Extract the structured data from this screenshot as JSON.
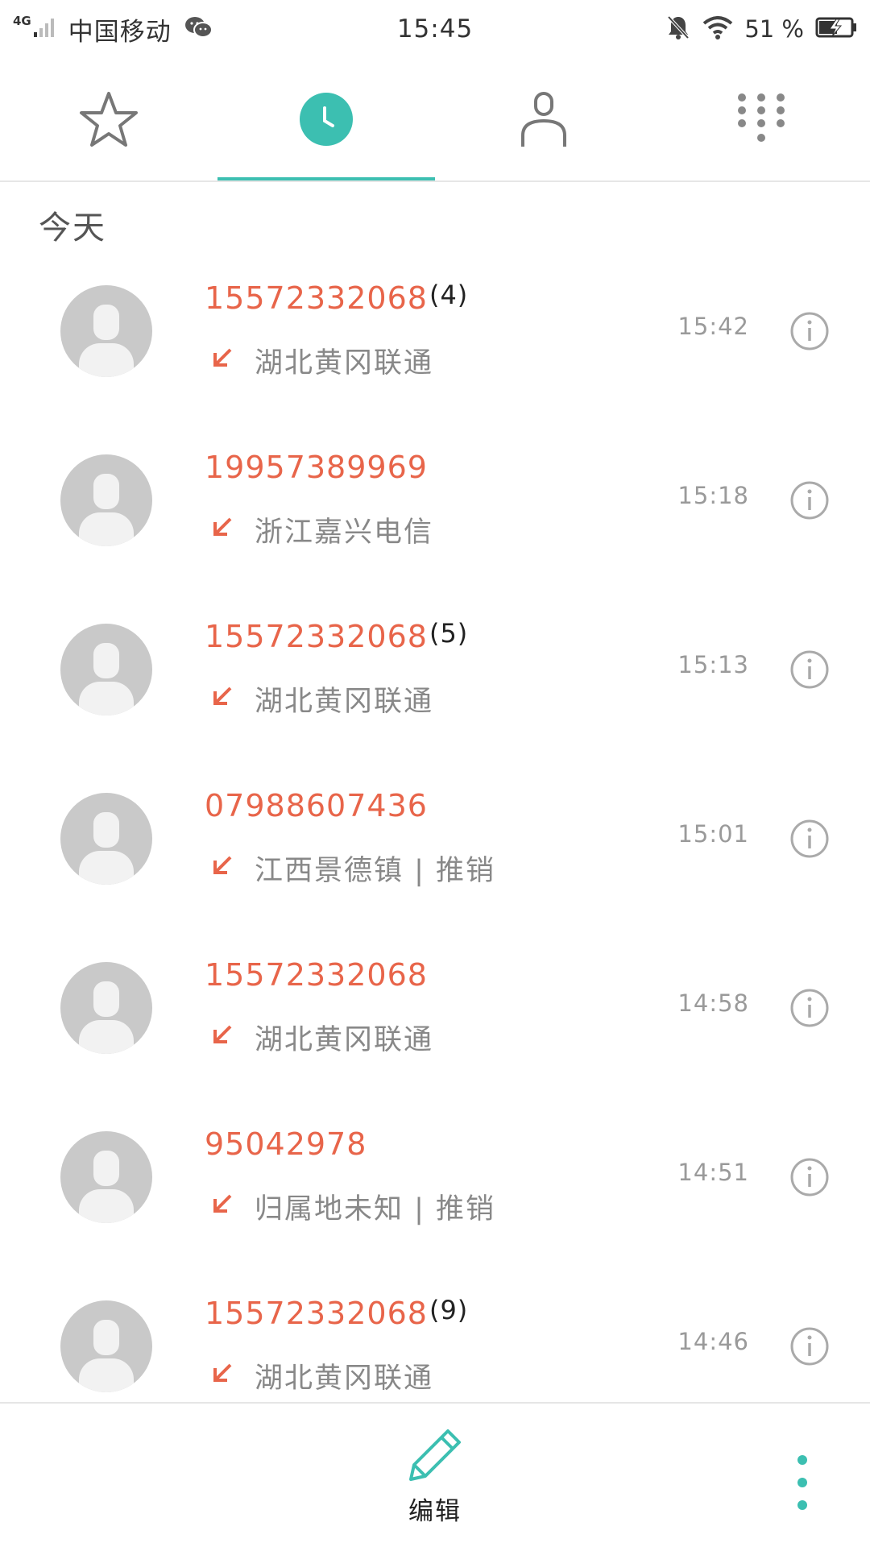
{
  "status_bar": {
    "network": "4G",
    "carrier": "中国移动",
    "time": "15:45",
    "battery_percent": "51 %",
    "icons": [
      "signal-icon",
      "wechat-icon",
      "mute-bell-icon",
      "wifi-icon",
      "battery-charging-icon"
    ]
  },
  "tabs": [
    {
      "name": "favorites",
      "icon": "star-icon",
      "selected": false
    },
    {
      "name": "recents",
      "icon": "clock-icon",
      "selected": true
    },
    {
      "name": "contacts",
      "icon": "person-icon",
      "selected": false
    },
    {
      "name": "dialpad",
      "icon": "dialpad-icon",
      "selected": false
    }
  ],
  "colors": {
    "accent": "#3cbfb1",
    "missed": "#e8654a",
    "avatar": "#c9c9c9"
  },
  "section_header": "今天",
  "calls": [
    {
      "number": "15572332068",
      "count": "(4)",
      "location": "湖北黄冈联通",
      "time": "15:42",
      "type": "incoming"
    },
    {
      "number": "19957389969",
      "count": "",
      "location": "浙江嘉兴电信",
      "time": "15:18",
      "type": "incoming"
    },
    {
      "number": "15572332068",
      "count": "(5)",
      "location": "湖北黄冈联通",
      "time": "15:13",
      "type": "incoming"
    },
    {
      "number": "07988607436",
      "count": "",
      "location": "江西景德镇 | 推销",
      "time": "15:01",
      "type": "incoming"
    },
    {
      "number": "15572332068",
      "count": "",
      "location": "湖北黄冈联通",
      "time": "14:58",
      "type": "incoming"
    },
    {
      "number": "95042978",
      "count": "",
      "location": "归属地未知 | 推销",
      "time": "14:51",
      "type": "incoming"
    },
    {
      "number": "15572332068",
      "count": "(9)",
      "location": "湖北黄冈联通",
      "time": "14:46",
      "type": "incoming"
    }
  ],
  "bottom_bar": {
    "edit_label": "编辑",
    "edit_icon": "pencil-icon",
    "more_icon": "more-vertical-icon"
  }
}
